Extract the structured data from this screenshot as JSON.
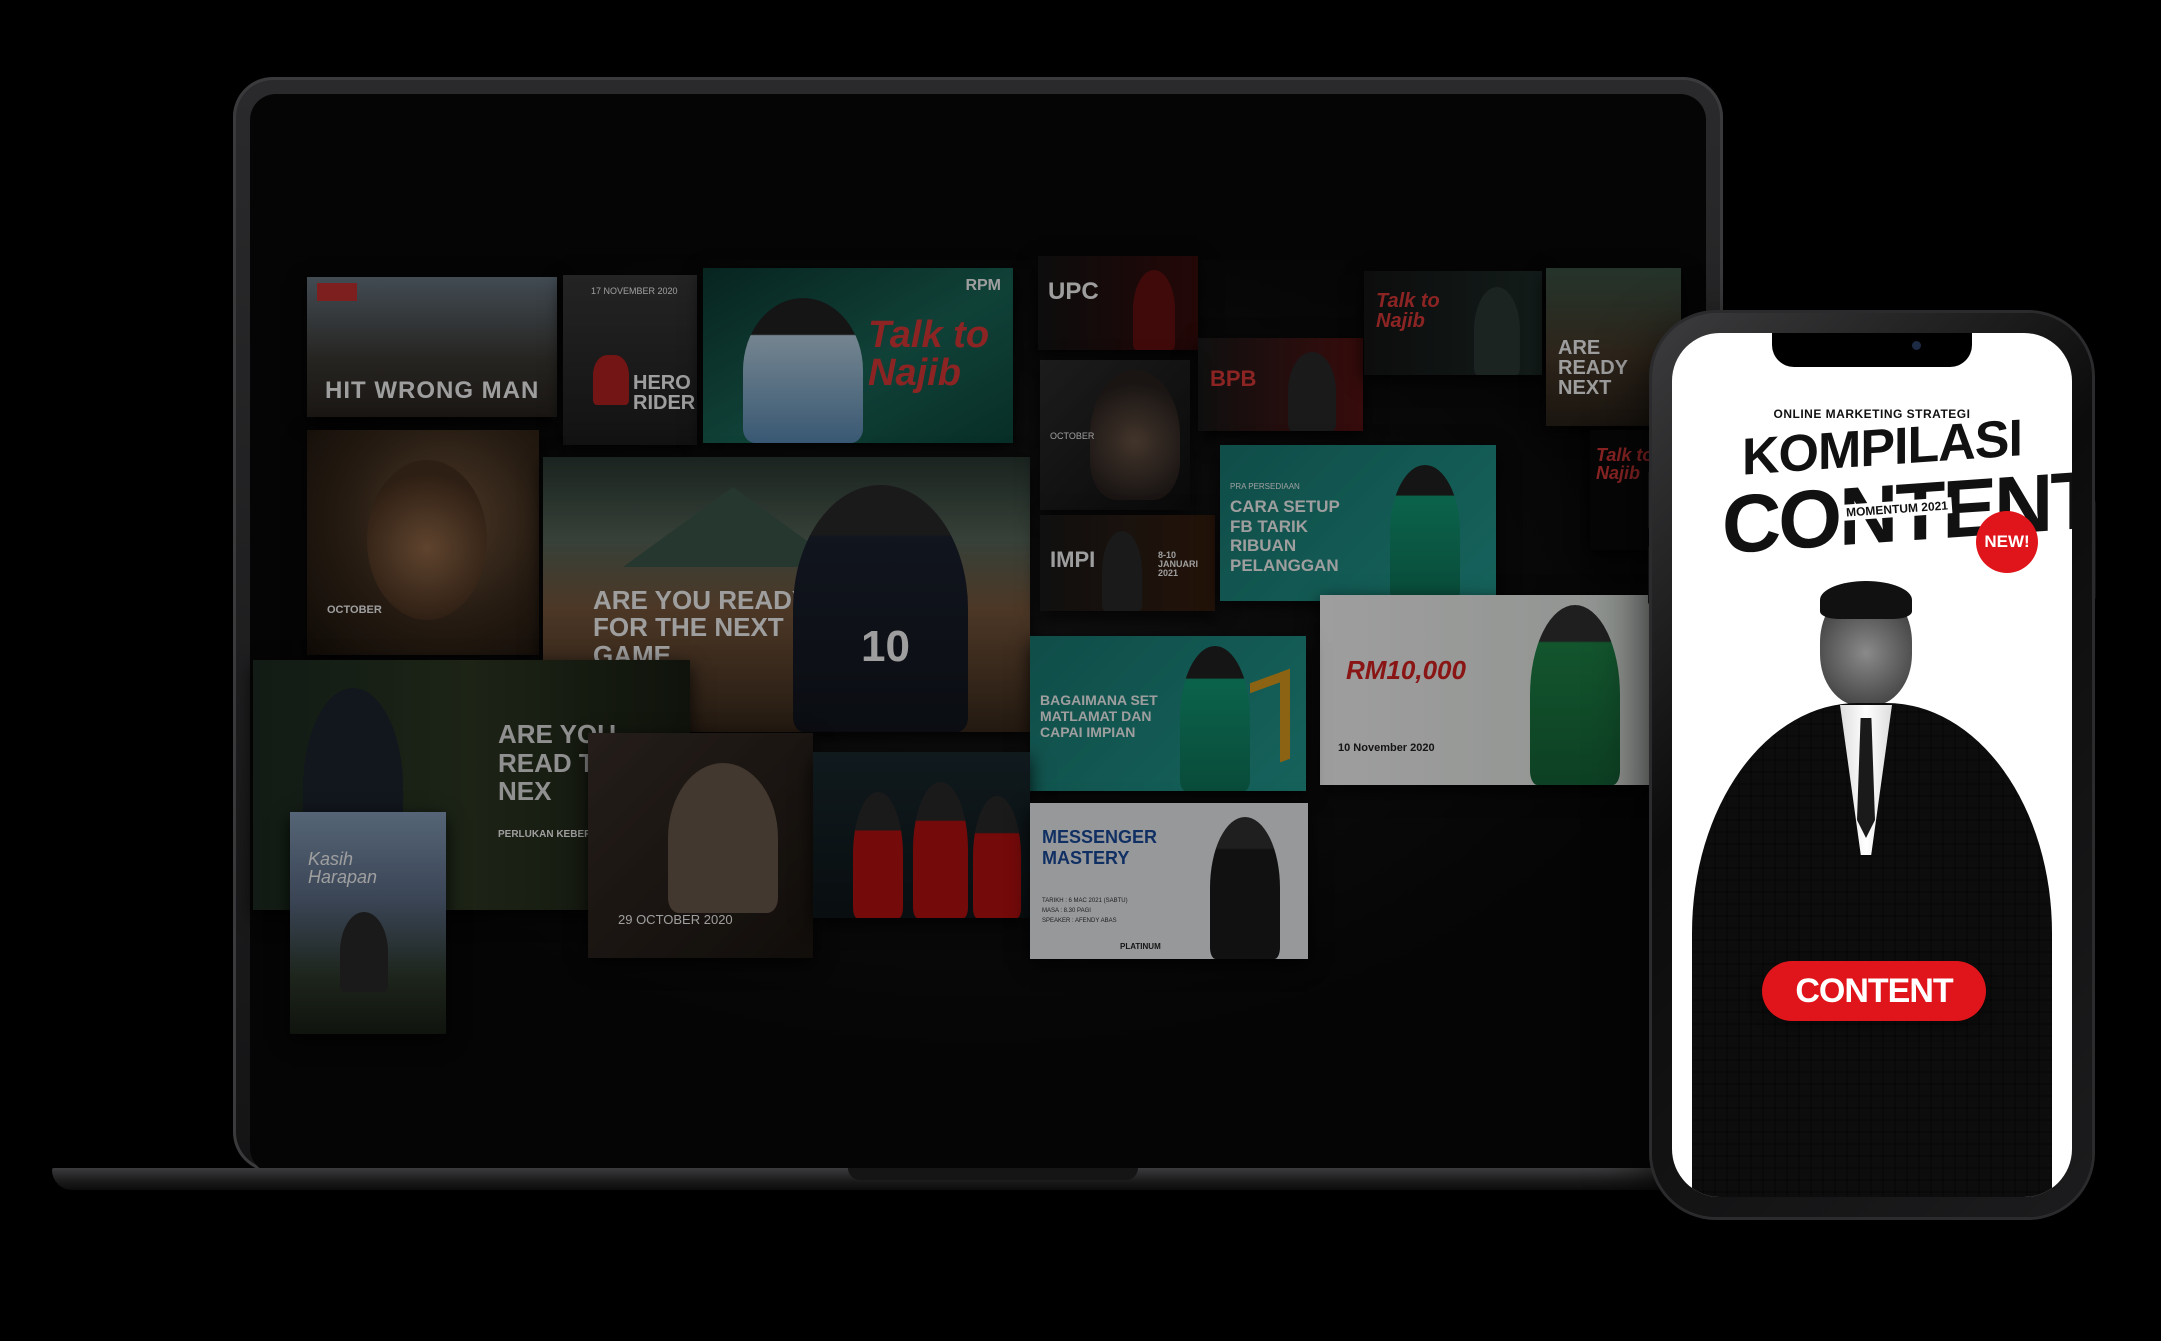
{
  "laptop_cards": [
    {
      "title": "HIT WRONG MAN",
      "accent": "#e0403a"
    },
    {
      "title": "17 NOVEMBER 2020"
    },
    {
      "title": "HERO RIDER"
    },
    {
      "title": "Talk to Najib"
    },
    {
      "title": "RPM"
    },
    {
      "title": "UPC"
    },
    {
      "title": "BPB"
    },
    {
      "title": "OCTOBER"
    },
    {
      "title": "IMPI"
    },
    {
      "title": "8-10 JANUARI 2021"
    },
    {
      "title": "Talk to Najib"
    },
    {
      "title": "ARE READY NEXT"
    },
    {
      "title": "Talk to Najib"
    },
    {
      "title": "OCTOBER"
    },
    {
      "title": "ARE YOU READY FOR THE NEXT GAME"
    },
    {
      "title": "10"
    },
    {
      "title": "CARA SETUP FB TARIK RIBUAN PELANGGAN"
    },
    {
      "title": "PRA PERSEDIAAN"
    },
    {
      "title": "BAGAIMANA SET MATLAMAT DAN CAPAI IMPIAN"
    },
    {
      "title": "RM10,000"
    },
    {
      "title": "10 November 2020"
    },
    {
      "title": "ARE YOU READ THE NEX"
    },
    {
      "title": "PERLUKAN KEBERAI"
    },
    {
      "title": "Kasih Harapan"
    },
    {
      "title": "29 OCTOBER 2020"
    },
    {
      "title": "MESSENGER MASTERY"
    },
    {
      "title": "TARIKH : 6 MAC 2021 (SABTU)"
    },
    {
      "title": "MASA : 8.30 PAGI"
    },
    {
      "title": "SPEAKER : AFENDY ABAS"
    },
    {
      "title": "PLATINUM"
    }
  ],
  "phone": {
    "subtitle": "ONLINE MARKETING STRATEGI",
    "title_line1": "KOMPILASI",
    "title_line2": "CONTENT",
    "edition": "MOMENTUM 2021",
    "badge": "NEW!",
    "cta": "CONTENT",
    "accent": "#e0151b"
  }
}
